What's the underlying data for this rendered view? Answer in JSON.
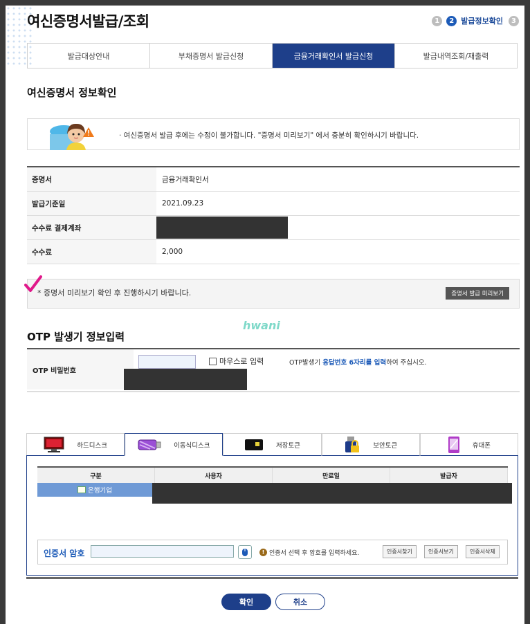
{
  "page": {
    "title": "여신증명서발급/조회"
  },
  "steps": {
    "items": [
      "1",
      "2",
      "3"
    ],
    "current_label": "발급정보확인"
  },
  "tabs": [
    {
      "label": "발급대상안내"
    },
    {
      "label": "부채증명서 발급신청"
    },
    {
      "label": "금융거래확인서 발급신청"
    },
    {
      "label": "발급내역조회/재출력"
    }
  ],
  "section1": {
    "title": "여신증명서 정보확인"
  },
  "notice": {
    "text": "· 여신증명서 발급 후에는 수정이 불가합니다. \"증명서 미리보기\" 에서 충분히 확인하시기 바랍니다."
  },
  "info": {
    "rows": [
      {
        "label": "증명서",
        "value": "금융거래확인서"
      },
      {
        "label": "발급기준일",
        "value": "2021.09.23"
      },
      {
        "label": "수수료 결제계좌",
        "value": ""
      },
      {
        "label": "수수료",
        "value": "2,000"
      }
    ]
  },
  "preview": {
    "text": "* 증명서 미리보기 확인 후 진행하시기 바랍니다.",
    "button": "증명서 발급 미리보기"
  },
  "watermark": "hwani",
  "otp_section": {
    "title": "OTP 발생기 정보입력"
  },
  "otp": {
    "label": "OTP 비밀번호",
    "mouse_label": "마우스로 입력",
    "hint_pre": "OTP발생기 ",
    "hint_bold": "응답번호 6자리를 입력",
    "hint_post": "하여 주십시오."
  },
  "cert_tabs": [
    {
      "label": "하드디스크",
      "icon": "monitor-icon"
    },
    {
      "label": "이동식디스크",
      "icon": "usb-drive-icon"
    },
    {
      "label": "저장토큰",
      "icon": "token-icon"
    },
    {
      "label": "보안토큰",
      "icon": "lock-token-icon"
    },
    {
      "label": "휴대폰",
      "icon": "phone-icon"
    }
  ],
  "cert_table": {
    "headers": [
      "구분",
      "사용자",
      "만료일",
      "발급자"
    ],
    "selected_row": "은행기업"
  },
  "cert_password": {
    "label": "인증서 암호",
    "message": "인증서 선택 후 암호를 입력하세요.",
    "buttons": [
      "인증서찾기",
      "인증서보기",
      "인증서삭제"
    ]
  },
  "actions": {
    "ok": "확인",
    "cancel": "취소"
  }
}
